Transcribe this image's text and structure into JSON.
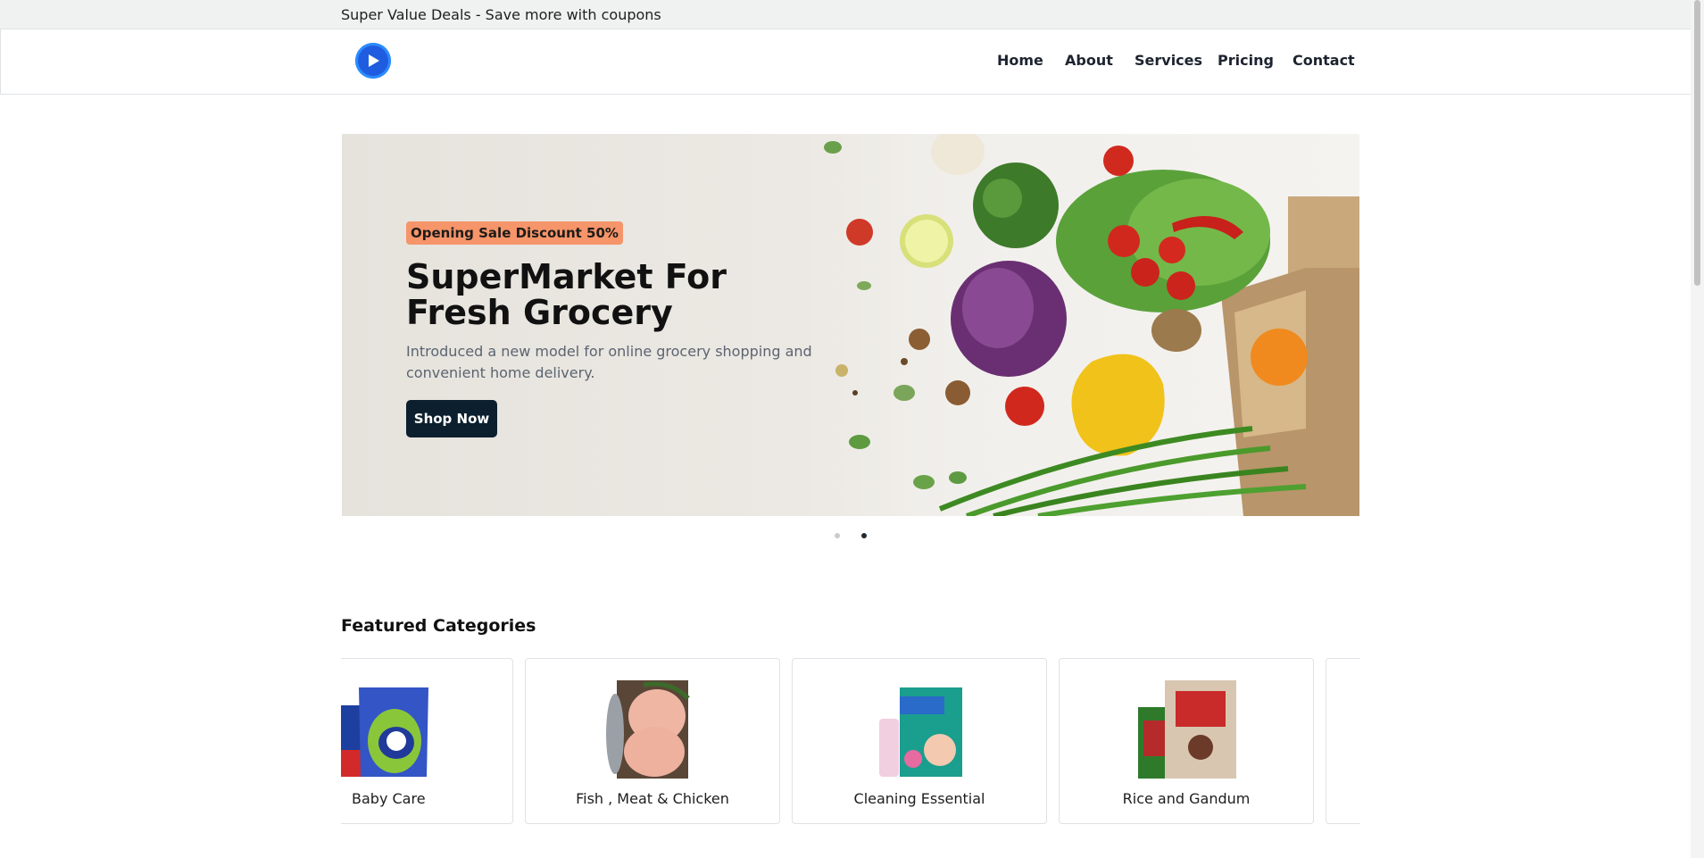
{
  "topbar": {
    "text": "Super Value Deals - Save more with coupons"
  },
  "header": {
    "logo_icon": "play-circle-icon",
    "nav": [
      "Home",
      "About",
      "Services",
      "Pricing",
      "Contact"
    ]
  },
  "hero": {
    "badge": "Opening Sale Discount 50%",
    "title": "SuperMarket For Fresh Grocery",
    "description": "Introduced a new model for online grocery shopping and convenient home delivery.",
    "button": "Shop Now",
    "slides": 2,
    "active_slide": 2
  },
  "categories": {
    "title": "Featured Categories",
    "items": [
      {
        "label": "Baby Care"
      },
      {
        "label": "Fish , Meat & Chicken"
      },
      {
        "label": "Cleaning Essential"
      },
      {
        "label": "Rice and Gandum"
      }
    ]
  },
  "colors": {
    "brand": "#1f5ce0",
    "badge": "#f6946a",
    "button": "#0b1f2e"
  }
}
